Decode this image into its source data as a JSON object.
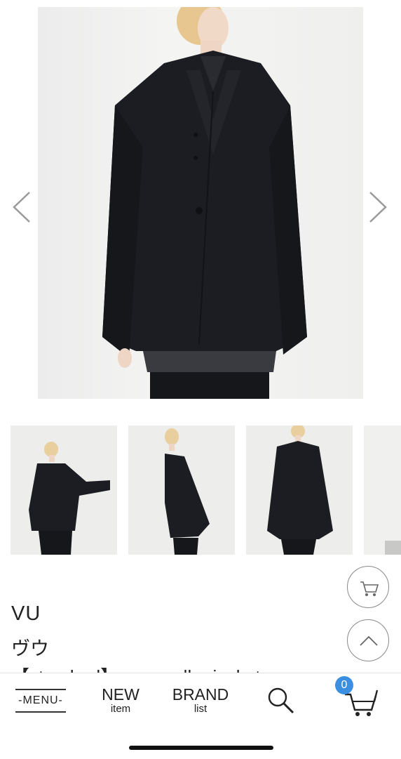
{
  "gallery": {
    "main_image_icon": "model-wearing-black-jacket-photo",
    "prev_icon": "chevron-left-icon",
    "next_icon": "chevron-right-icon",
    "thumbnails": [
      {
        "icon": "model-arm-extended-photo"
      },
      {
        "icon": "model-side-view-photo"
      },
      {
        "icon": "model-front-view-photo"
      },
      {
        "icon": "partial-photo"
      }
    ]
  },
  "floating": {
    "cart_icon": "cart-icon",
    "scroll_top_icon": "chevron-up-icon"
  },
  "product": {
    "brand_en": "VU",
    "brand_ja": "ヴウ",
    "name": "【standard】 over collar jacket"
  },
  "bottom_nav": {
    "menu_label": "MENU",
    "new_label": "NEW",
    "new_sub": "item",
    "brand_label": "BRAND",
    "brand_sub": "list",
    "search_icon": "search-icon",
    "cart_icon": "cart-icon",
    "cart_count": "0"
  },
  "colors": {
    "badge": "#3b8fe0",
    "garment": "#1c1d22",
    "background": "#ffffff"
  }
}
